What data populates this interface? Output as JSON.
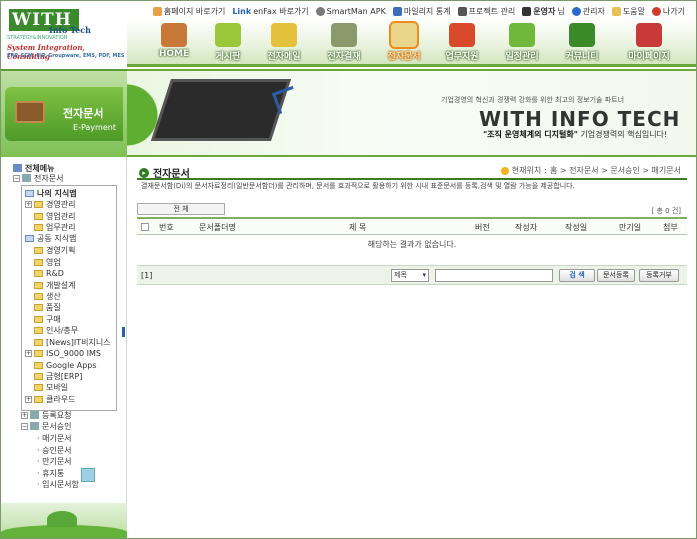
{
  "logo": {
    "mark": "WITH",
    "sub": "Info Tech",
    "tagline": "STRATEGY&INNOVATION",
    "line1": "System Integration, Consulting",
    "line2": "ERP, SCM, EIP, Groupware, EMS, PDF, MES"
  },
  "util": [
    "홈페이지 바로가기",
    "enFax 바로가기",
    "SmartMan APK",
    "마일리지 통계",
    "프로젝트 관리"
  ],
  "user": {
    "name": "운영자",
    "suffix": "님",
    "admin": "관리자",
    "help": "도움말",
    "logout": "나가기"
  },
  "nav": [
    "HOME",
    "게시판",
    "전자메일",
    "전자결재",
    "전자문서",
    "업무지원",
    "일정관리",
    "커뮤니티",
    "마이페이지"
  ],
  "left_banner": {
    "title": "전자문서",
    "subtitle": "E-Payment"
  },
  "main_banner": {
    "small": "기업경영의 혁신과 경쟁력 강화를 위한 최고의 정보기술 파트너",
    "big": "WITH INFO TECH",
    "sub_bold": "\"조직 운영체계의 디지털화\"",
    "sub_rest": " 기업경쟁력의 핵심입니다!"
  },
  "tree": {
    "root": "전체메뉴",
    "doc": "전자문서",
    "my": "나의 지식맵",
    "my_items": [
      "경영관리",
      "영업관리",
      "업무관리"
    ],
    "common": "공동 지식맵",
    "common_items": [
      "경영기획",
      "영업",
      "R&D",
      "개발설계",
      "생산",
      "품질",
      "구매",
      "인사/총무",
      "[News]IT비지니스",
      "ISO_9000 IMS",
      "Google Apps",
      "금형[ERP]",
      "모바일",
      "클라우드"
    ],
    "reg": "등록요청",
    "approve": "문서승인",
    "approve_items": [
      "매기문서",
      "승인문서",
      "만기문서",
      "휴지통",
      "임시문서함"
    ]
  },
  "page": {
    "title": "전자문서",
    "crumb_label": "현재위치",
    "crumb": "홈 > 전자문서 > 문서승인 > 매기문서",
    "desc": "결재문서함(Di)의 문서자료정리(일반문서함더)를 관리하며, 문서를 효과적으로 활용하기 위한 시내 표준문서를 등록,검색 및 열람 가능을 제공합니다.",
    "filter": "전 체",
    "count": "[ 총 0 건]",
    "headers": [
      "번호",
      "문서폴더명",
      "제 목",
      "버전",
      "작성자",
      "작성일",
      "만기일",
      "첨부"
    ],
    "empty": "해당하는 결과가 없습니다.",
    "pager": "[1]",
    "search_field": "제목",
    "search_btn": "검 색",
    "reg_btn": "문서등록",
    "reject_btn": "등록거부"
  }
}
